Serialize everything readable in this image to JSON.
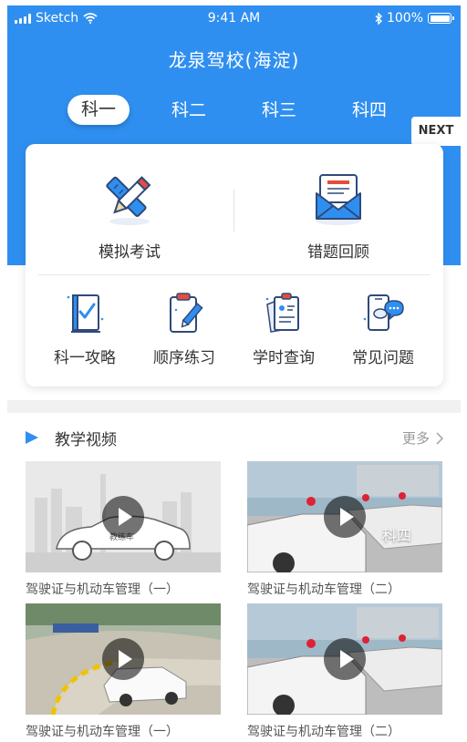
{
  "status_bar": {
    "carrier": "Sketch",
    "time": "9:41 AM",
    "battery": "100%"
  },
  "header": {
    "title": "龙泉驾校(海淀)"
  },
  "tabs": [
    {
      "label": "科一",
      "active": true
    },
    {
      "label": "科二",
      "active": false
    },
    {
      "label": "科三",
      "active": false
    },
    {
      "label": "科四",
      "active": false
    }
  ],
  "next_label": "NEXT",
  "card": {
    "main": [
      {
        "label": "模拟考试",
        "icon": "pencil-ruler-icon"
      },
      {
        "label": "错题回顾",
        "icon": "envelope-icon"
      }
    ],
    "sub": [
      {
        "label": "科一攻略",
        "icon": "book-check-icon"
      },
      {
        "label": "顺序练习",
        "icon": "clipboard-pen-icon"
      },
      {
        "label": "学时查询",
        "icon": "document-search-icon"
      },
      {
        "label": "常见问题",
        "icon": "phone-chat-icon"
      }
    ]
  },
  "section": {
    "title": "教学视频",
    "more": "更多"
  },
  "videos": [
    {
      "caption": "驾驶证与机动车管理（一）"
    },
    {
      "caption": "驾驶证与机动车管理（二）",
      "overlay": "科四"
    },
    {
      "caption": "驾驶证与机动车管理（一）"
    },
    {
      "caption": "驾驶证与机动车管理（二）"
    }
  ],
  "colors": {
    "primary": "#2f8ff0",
    "accent_red": "#e74c3c",
    "icon_dark": "#2f4a7a"
  }
}
